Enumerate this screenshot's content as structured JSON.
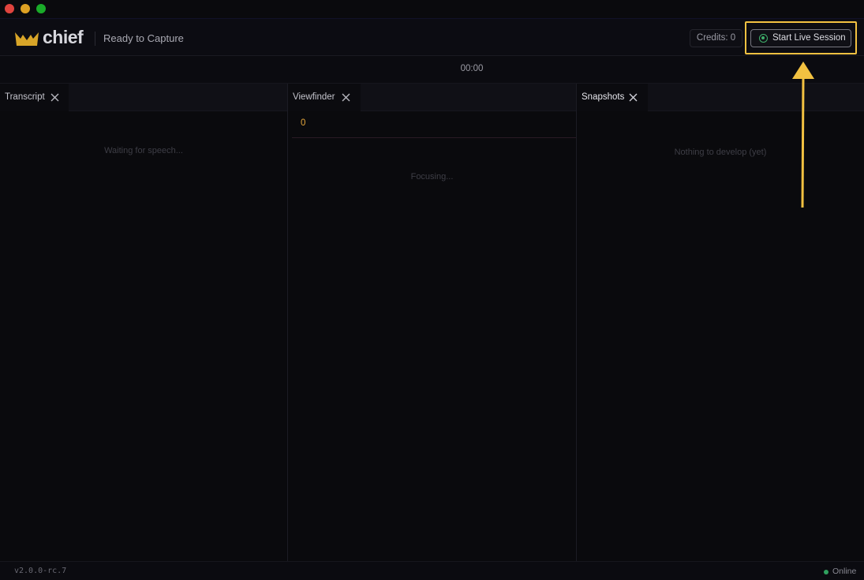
{
  "window": {
    "controls": [
      "close",
      "minimize",
      "maximize"
    ]
  },
  "header": {
    "logo_text": "chief",
    "logo_icon": "crown-icon",
    "status": "Ready to Capture",
    "credits_label": "Credits: 0",
    "start_button_label": "Start Live Session",
    "start_button_icon": "record-icon"
  },
  "timer": {
    "value": "00:00"
  },
  "panels": [
    {
      "tab_label": "Transcript",
      "empty_message": "Waiting for speech..."
    },
    {
      "tab_label": "Viewfinder",
      "counter": "0",
      "empty_message": "Focusing..."
    },
    {
      "tab_label": "Snapshots",
      "empty_message": "Nothing to develop (yet)"
    }
  ],
  "footer": {
    "version": "v2.0.0-rc.7",
    "connection_status": "Online"
  },
  "colors": {
    "accent_highlight": "#f2c141",
    "logo_gold": "#d8a528",
    "online_green": "#2fa05e",
    "counter_orange": "#e7a83c"
  }
}
